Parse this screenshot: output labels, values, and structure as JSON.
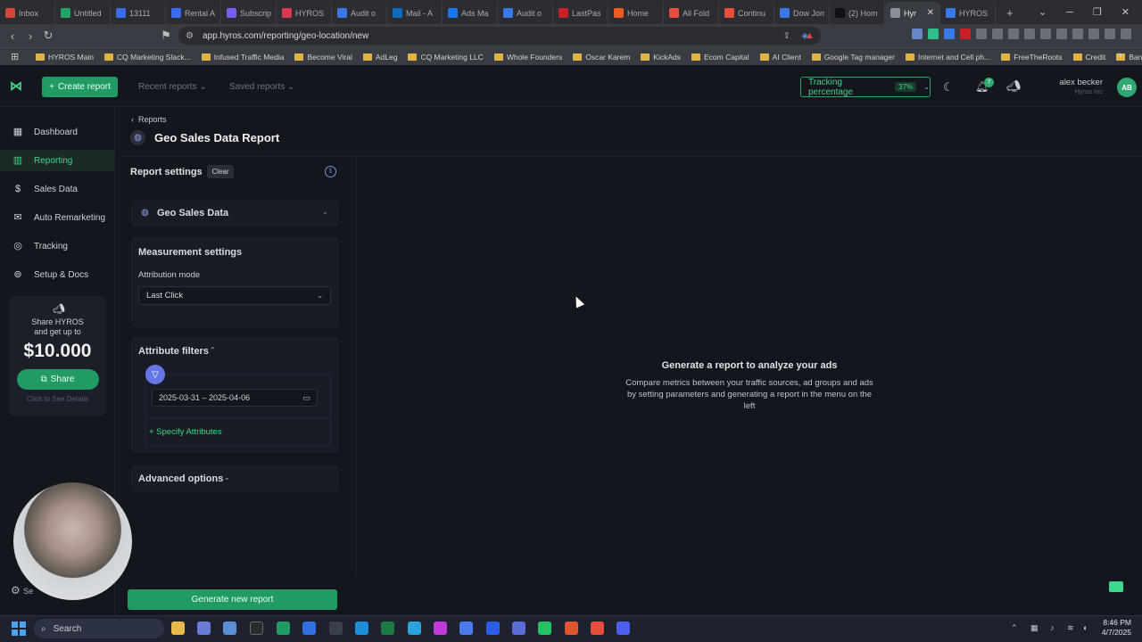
{
  "browser": {
    "tabs": [
      {
        "label": "Inbox",
        "color": "#d44638"
      },
      {
        "label": "Untitled",
        "color": "#21a366"
      },
      {
        "label": "13111",
        "color": "#3b6cf0"
      },
      {
        "label": "Rental A",
        "color": "#3b6cf0"
      },
      {
        "label": "Subscrip",
        "color": "#7b5cf0"
      },
      {
        "label": "HYROS",
        "color": "#d8394f"
      },
      {
        "label": "Audit o",
        "color": "#3b78e7"
      },
      {
        "label": "Mail - A",
        "color": "#0f6cbd"
      },
      {
        "label": "Ads Ma",
        "color": "#1877f2"
      },
      {
        "label": "Audit o",
        "color": "#3b78e7"
      },
      {
        "label": "LastPas",
        "color": "#cc2029"
      },
      {
        "label": "Home",
        "color": "#f05a22"
      },
      {
        "label": "All Fold",
        "color": "#e94d3c"
      },
      {
        "label": "Continu",
        "color": "#e94d3c"
      },
      {
        "label": "Dow Jon",
        "color": "#3b78e7"
      },
      {
        "label": "(2) Hom",
        "color": "#111111"
      },
      {
        "label": "Hyr",
        "color": "#8b8e96"
      },
      {
        "label": "HYROS",
        "color": "#3b78e7"
      }
    ],
    "active_tab_index": 16,
    "url": "app.hyros.com/reporting/geo-location/new",
    "bookmarks": [
      "HYROS Main",
      "CQ Marketing Slack...",
      "Infused Traffic Media",
      "Become Viral",
      "AdLeg",
      "CQ Marketing LLC",
      "Whole Founders",
      "Oscar Karem",
      "KickAds",
      "Ecom Capital",
      "AI Client",
      "Google Tag manager",
      "Internet and Cell ph...",
      "FreeTheRoots",
      "Credit",
      "Banks"
    ]
  },
  "header": {
    "create_report": "Create report",
    "recent_reports": "Recent reports",
    "saved_reports": "Saved reports",
    "tracking_label": "Tracking percentage",
    "tracking_value": "37%",
    "notification_count": "7",
    "user_name": "alex becker",
    "user_company": "Hyros Inc",
    "avatar_initials": "AB"
  },
  "sidebar": {
    "items": [
      {
        "label": "Dashboard",
        "icon": "grid-icon"
      },
      {
        "label": "Reporting",
        "icon": "chart-icon"
      },
      {
        "label": "Sales Data",
        "icon": "dollar-icon"
      },
      {
        "label": "Auto Remarketing",
        "icon": "mail-icon"
      },
      {
        "label": "Tracking",
        "icon": "target-icon"
      },
      {
        "label": "Setup & Docs",
        "icon": "book-icon"
      }
    ],
    "active_index": 1,
    "promo": {
      "line1": "Share HYROS",
      "line2": "and get up to",
      "amount": "$10.000",
      "button": "Share",
      "see_details": "Click to See Details"
    },
    "bottom_label": "Se"
  },
  "main": {
    "breadcrumb": "Reports",
    "title": "Geo Sales Data Report",
    "report_settings": "Report settings",
    "clear": "Clear",
    "geo_sales_data": "Geo Sales Data",
    "measurement_settings": "Measurement settings",
    "attribution_mode_label": "Attribution mode",
    "attribution_mode_value": "Last Click",
    "attribute_filters": "Attribute filters",
    "date_range": "2025-03-31 – 2025-04-06",
    "specify_attributes": "+ Specify Attributes",
    "advanced_options": "Advanced options",
    "generate_button": "Generate new report",
    "empty_title": "Generate a report to analyze your ads",
    "empty_description": "Compare metrics between your traffic sources, ad groups and ads by setting parameters and generating a report in the menu on the left"
  },
  "taskbar": {
    "search_placeholder": "Search",
    "time": "8:46 PM",
    "date": "4/7/2025"
  }
}
